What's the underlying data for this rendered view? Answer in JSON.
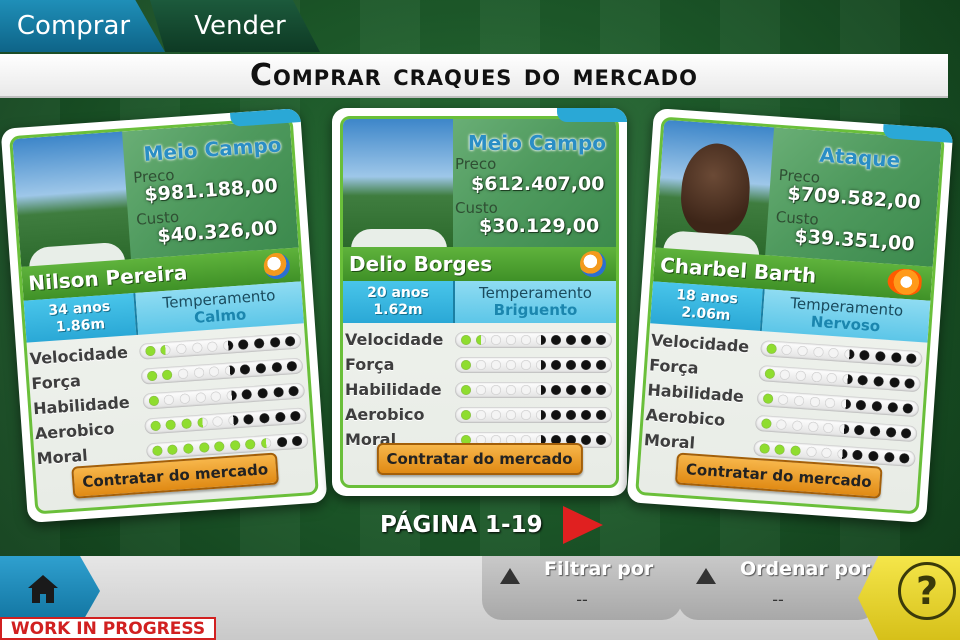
{
  "tabs": [
    {
      "label": "Comprar"
    },
    {
      "label": "Vender"
    }
  ],
  "title": "Comprar craques do mercado",
  "labels": {
    "price": "Preco",
    "cost": "Custo"
  },
  "stat_names": [
    "Velocidade",
    "Força",
    "Habilidade",
    "Aerobico",
    "Moral"
  ],
  "cards": [
    {
      "position": "Meio Campo",
      "price": "$981.188,00",
      "cost": "$40.326,00",
      "name": "Nilson Pereira",
      "age": "34 anos",
      "height": "1.86m",
      "temperament_label": "Temperamento",
      "temperament": "Calmo",
      "stats": [
        1.5,
        2.0,
        1.0,
        3.5,
        7.5
      ],
      "hire_label": "Contratar do mercado"
    },
    {
      "position": "Meio Campo",
      "price": "$612.407,00",
      "cost": "$30.129,00",
      "name": "Delio Borges",
      "age": "20 anos",
      "height": "1.62m",
      "temperament_label": "Temperamento",
      "temperament": "Briguento",
      "stats": [
        1.5,
        1.0,
        1.0,
        1.0,
        1.0
      ],
      "hire_label": "Contratar do mercado"
    },
    {
      "position": "Ataque",
      "price": "$709.582,00",
      "cost": "$39.351,00",
      "name": "Charbel Barth",
      "age": "18 anos",
      "height": "2.06m",
      "temperament_label": "Temperamento",
      "temperament": "Nervoso",
      "stats": [
        1.0,
        1.0,
        1.0,
        1.0,
        3.0
      ],
      "hire_label": "Contratar do mercado"
    }
  ],
  "pagination": {
    "label": "PÁGINA 1-19"
  },
  "filters": [
    {
      "label": "Filtrar por",
      "value": "--"
    },
    {
      "label": "Ordenar por",
      "value": "--"
    }
  ],
  "help_symbol": "?",
  "wip_label": "WORK IN PROGRESS",
  "colors": {
    "accent": "#2aa8d6",
    "card_green": "#6abf3a",
    "button_orange": "#e08a14",
    "help_yellow": "#f5e64a",
    "next_red": "#e02020"
  }
}
